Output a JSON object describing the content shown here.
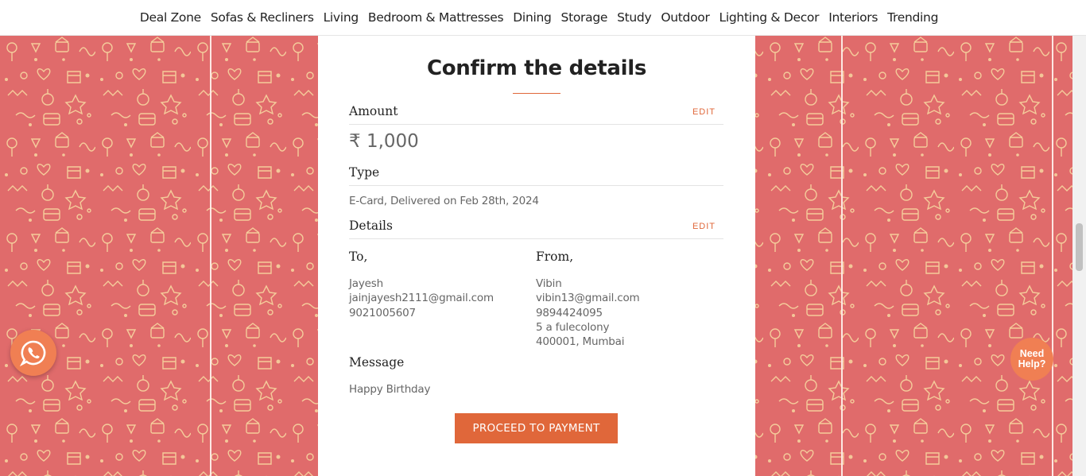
{
  "nav": {
    "items": [
      "Deal Zone",
      "Sofas & Recliners",
      "Living",
      "Bedroom & Mattresses",
      "Dining",
      "Storage",
      "Study",
      "Outdoor",
      "Lighting & Decor",
      "Interiors",
      "Trending"
    ]
  },
  "card": {
    "title": "Confirm the details",
    "amount": {
      "label": "Amount",
      "edit": "EDIT",
      "value": "₹ 1,000"
    },
    "type": {
      "label": "Type",
      "value": "E-Card, Delivered on Feb 28th, 2024"
    },
    "details": {
      "label": "Details",
      "edit": "EDIT",
      "to": {
        "label": "To,",
        "name": "Jayesh",
        "email": "jainjayesh2111@gmail.com",
        "phone": "9021005607"
      },
      "from": {
        "label": "From,",
        "name": "Vibin",
        "email": "vibin13@gmail.com",
        "phone": "9894424095",
        "address_line": "5 a fulecolony",
        "city": "400001, Mumbai"
      }
    },
    "message": {
      "label": "Message",
      "value": "Happy Birthday"
    },
    "proceed_label": "PROCEED TO PAYMENT"
  },
  "help": {
    "line1": "Need",
    "line2": "Help?"
  },
  "colors": {
    "accent": "#e0673a",
    "background_pattern": "#e06b6b",
    "pattern_motif": "#f7d7a0"
  },
  "icons": {
    "whatsapp": "whatsapp-icon"
  }
}
